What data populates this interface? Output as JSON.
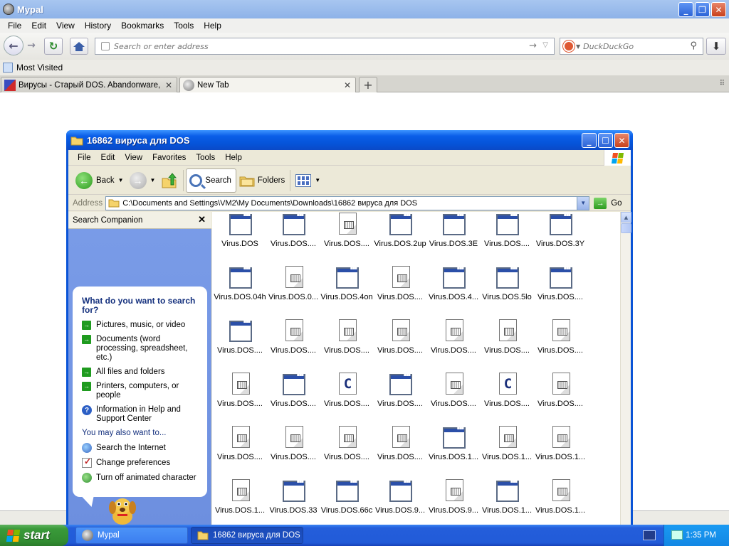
{
  "browser": {
    "title": "Mypal",
    "menu": [
      "File",
      "Edit",
      "View",
      "History",
      "Bookmarks",
      "Tools",
      "Help"
    ],
    "url_placeholder": "Search or enter address",
    "search_placeholder": "DuckDuckGo",
    "bookmarks": [
      "Most Visited"
    ],
    "tabs": [
      {
        "label": "Вирусы - Старый DOS. Abandonware, c..."
      },
      {
        "label": "New Tab"
      }
    ]
  },
  "explorer": {
    "title": "16862 вируса для DOS",
    "menu": [
      "File",
      "Edit",
      "View",
      "Favorites",
      "Tools",
      "Help"
    ],
    "toolbar": {
      "back": "Back",
      "search": "Search",
      "folders": "Folders"
    },
    "address_label": "Address",
    "address_value": "C:\\Documents and Settings\\VM2\\My Documents\\Downloads\\16862 вируса для DOS",
    "go_label": "Go",
    "companion": {
      "header": "Search Companion",
      "question": "What do you want to search for?",
      "options": [
        "Pictures, music, or video",
        "Documents (word processing, spreadsheet, etc.)",
        "All files and folders",
        "Printers, computers, or people",
        "Information in Help and Support Center"
      ],
      "also_label": "You may also want to...",
      "also_options": [
        "Search the Internet",
        "Change preferences",
        "Turn off animated character"
      ]
    },
    "files": [
      {
        "name": "Virus.DOS",
        "icon": "app"
      },
      {
        "name": "Virus.DOS....",
        "icon": "app"
      },
      {
        "name": "Virus.DOS....",
        "icon": "doc"
      },
      {
        "name": "Virus.DOS.2up",
        "icon": "app"
      },
      {
        "name": "Virus.DOS.3E",
        "icon": "app"
      },
      {
        "name": "Virus.DOS....",
        "icon": "app"
      },
      {
        "name": "Virus.DOS.3Y",
        "icon": "app"
      },
      {
        "name": "Virus.DOS.04h",
        "icon": "app"
      },
      {
        "name": "Virus.DOS.0...",
        "icon": "doc"
      },
      {
        "name": "Virus.DOS.4on",
        "icon": "app"
      },
      {
        "name": "Virus.DOS....",
        "icon": "doc"
      },
      {
        "name": "Virus.DOS.4...",
        "icon": "app"
      },
      {
        "name": "Virus.DOS.5lo",
        "icon": "app"
      },
      {
        "name": "Virus.DOS....",
        "icon": "app"
      },
      {
        "name": "Virus.DOS....",
        "icon": "app"
      },
      {
        "name": "Virus.DOS....",
        "icon": "doc"
      },
      {
        "name": "Virus.DOS....",
        "icon": "doc"
      },
      {
        "name": "Virus.DOS....",
        "icon": "doc"
      },
      {
        "name": "Virus.DOS....",
        "icon": "doc"
      },
      {
        "name": "Virus.DOS....",
        "icon": "doc"
      },
      {
        "name": "Virus.DOS....",
        "icon": "doc"
      },
      {
        "name": "Virus.DOS....",
        "icon": "doc"
      },
      {
        "name": "Virus.DOS....",
        "icon": "app"
      },
      {
        "name": "Virus.DOS....",
        "icon": "c"
      },
      {
        "name": "Virus.DOS....",
        "icon": "app"
      },
      {
        "name": "Virus.DOS....",
        "icon": "doc"
      },
      {
        "name": "Virus.DOS....",
        "icon": "c"
      },
      {
        "name": "Virus.DOS....",
        "icon": "doc"
      },
      {
        "name": "Virus.DOS....",
        "icon": "doc"
      },
      {
        "name": "Virus.DOS....",
        "icon": "doc"
      },
      {
        "name": "Virus.DOS....",
        "icon": "doc"
      },
      {
        "name": "Virus.DOS....",
        "icon": "doc"
      },
      {
        "name": "Virus.DOS.1...",
        "icon": "app"
      },
      {
        "name": "Virus.DOS.1...",
        "icon": "doc"
      },
      {
        "name": "Virus.DOS.1...",
        "icon": "doc"
      },
      {
        "name": "Virus.DOS.1...",
        "icon": "doc"
      },
      {
        "name": "Virus.DOS.33",
        "icon": "app"
      },
      {
        "name": "Virus.DOS.66c",
        "icon": "app"
      },
      {
        "name": "Virus.DOS.9...",
        "icon": "app"
      },
      {
        "name": "Virus.DOS.9...",
        "icon": "doc"
      },
      {
        "name": "Virus.DOS.1...",
        "icon": "app"
      },
      {
        "name": "Virus.DOS.1...",
        "icon": "doc"
      }
    ]
  },
  "taskbar": {
    "start_label": "start",
    "tasks": [
      "Mypal",
      "16862 вируса для DOS"
    ],
    "clock": "1:35 PM"
  },
  "colors": {
    "xp_blue": "#0a54d6",
    "start_green": "#3a9a3a"
  }
}
